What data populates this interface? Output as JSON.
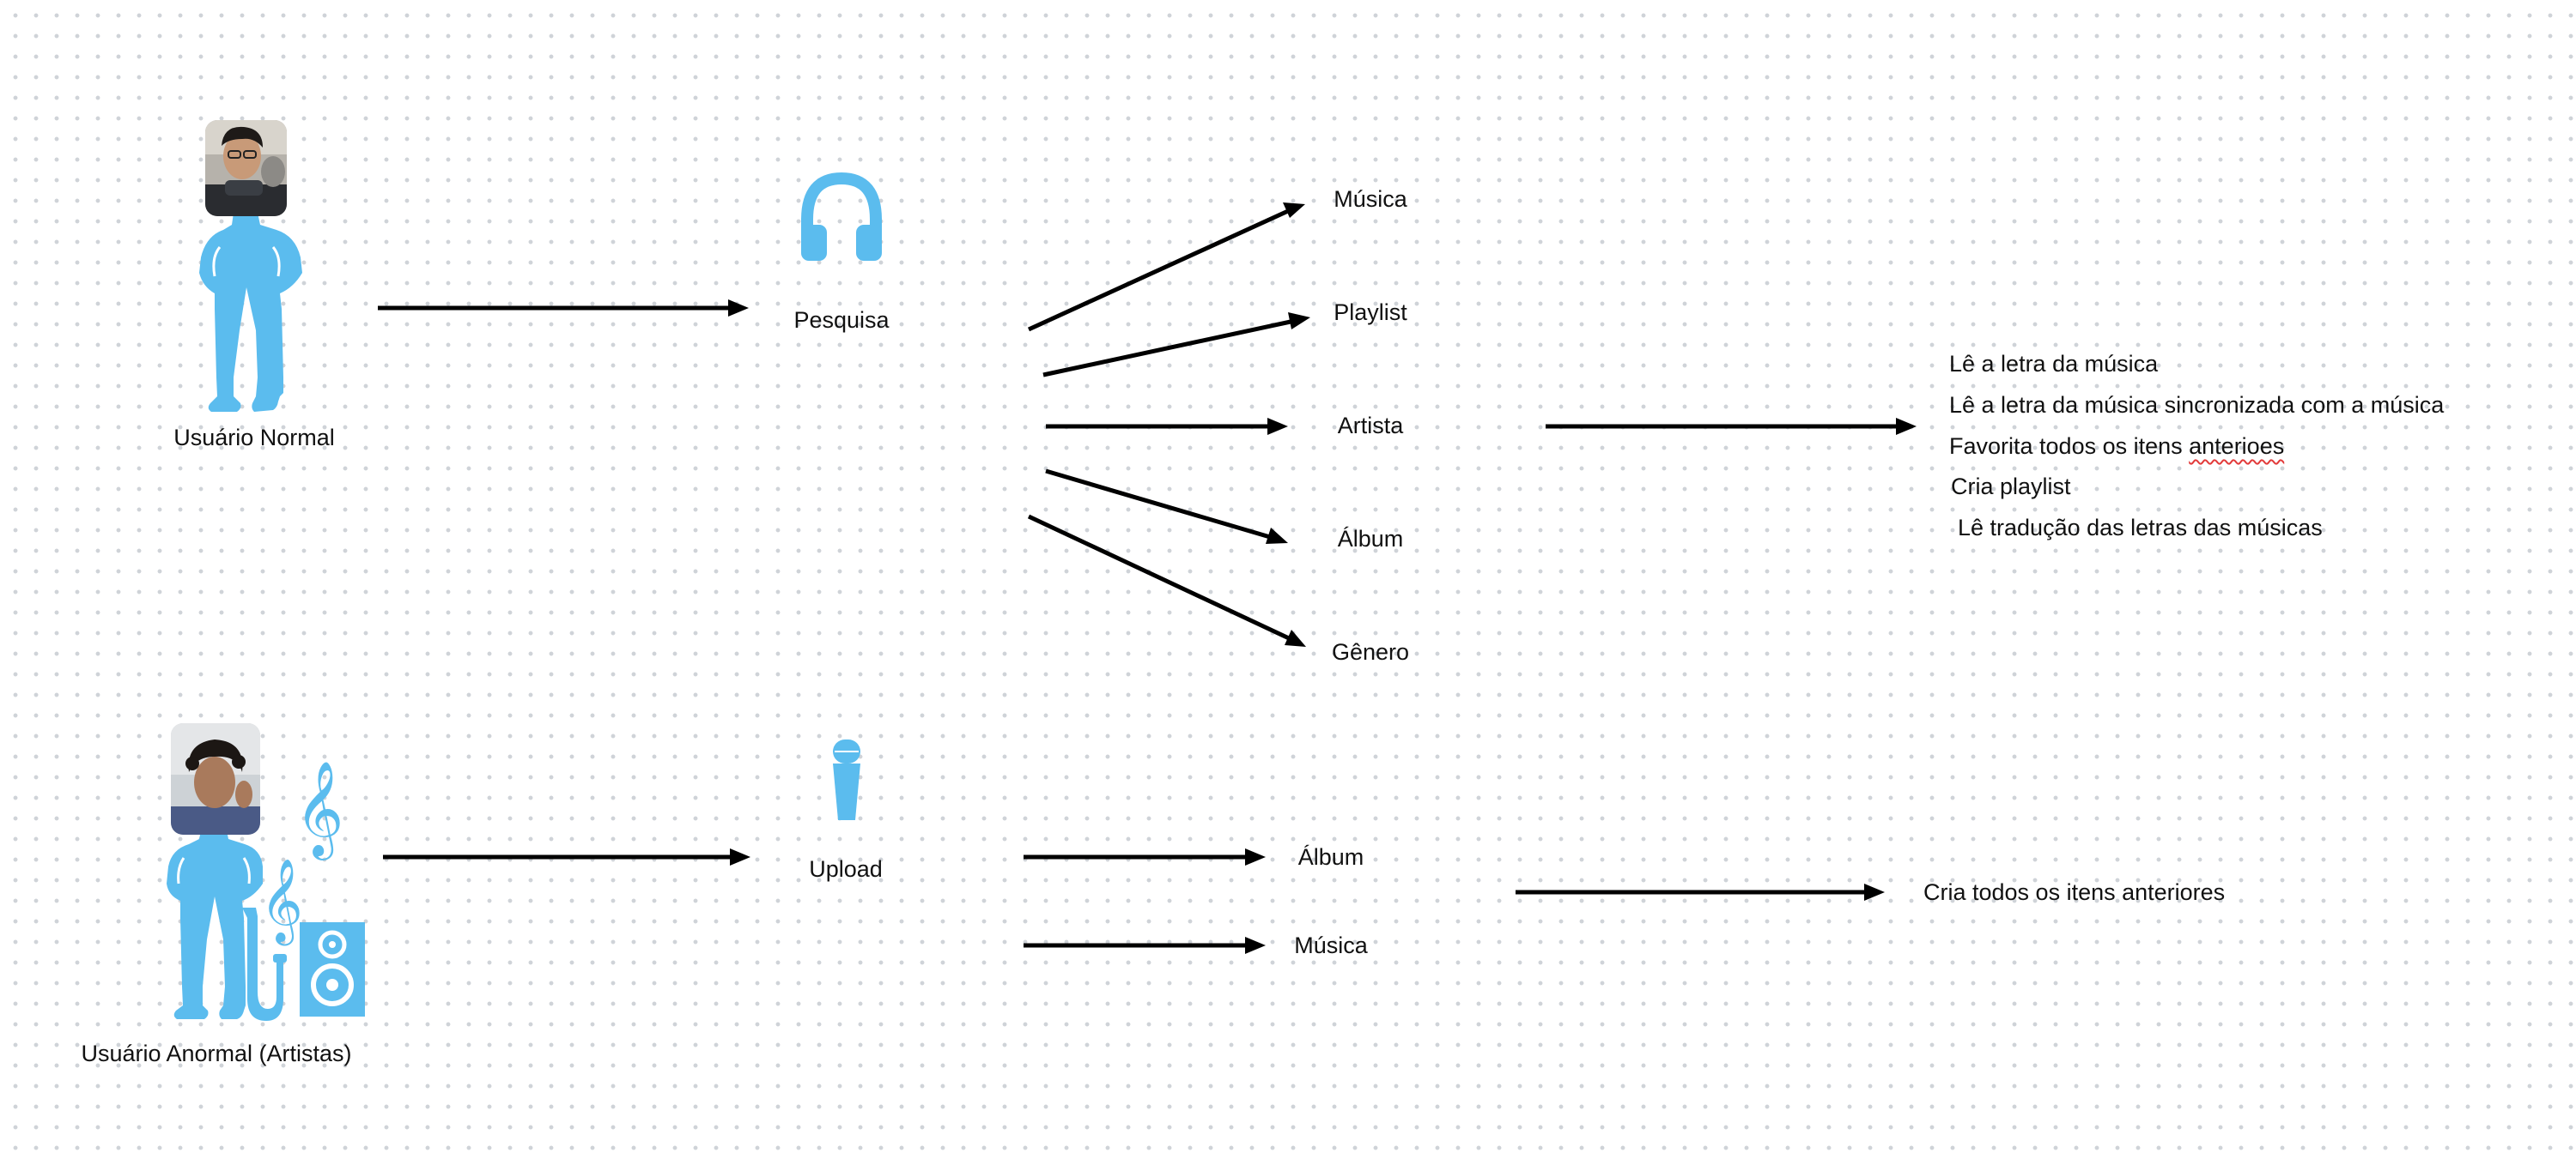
{
  "colors": {
    "figure": "#5BBCEE",
    "arrow": "#000000",
    "text": "#111111",
    "canvas": "#ffffff",
    "dots": "#cfd3d8"
  },
  "icons": {
    "normal_user": "person-silhouette-with-photo-icon",
    "search": "headphones-icon",
    "artist_user": "person-silhouette-with-photo-icon",
    "upload": "microphone-icon",
    "decorations": [
      "treble-clef-icon",
      "treble-clef-icon",
      "saxophone-icon",
      "speaker-icon"
    ]
  },
  "nodes": {
    "normal_user": "Usuário Normal",
    "search": "Pesquisa",
    "search_targets": [
      "Música",
      "Playlist",
      "Artista",
      "Álbum",
      "Gênero"
    ],
    "normal_actions": [
      "Lê a letra da música",
      "Lê a letra da música sincronizada com a música",
      "Favorita todos os itens ",
      "anterioes",
      "Cria playlist",
      "Lê tradução das letras das músicas"
    ],
    "artist_user": "Usuário Anormal (Artistas)",
    "upload": "Upload",
    "upload_targets": [
      "Álbum",
      "Música"
    ],
    "artist_action": "Cria todos os itens anteriores"
  }
}
